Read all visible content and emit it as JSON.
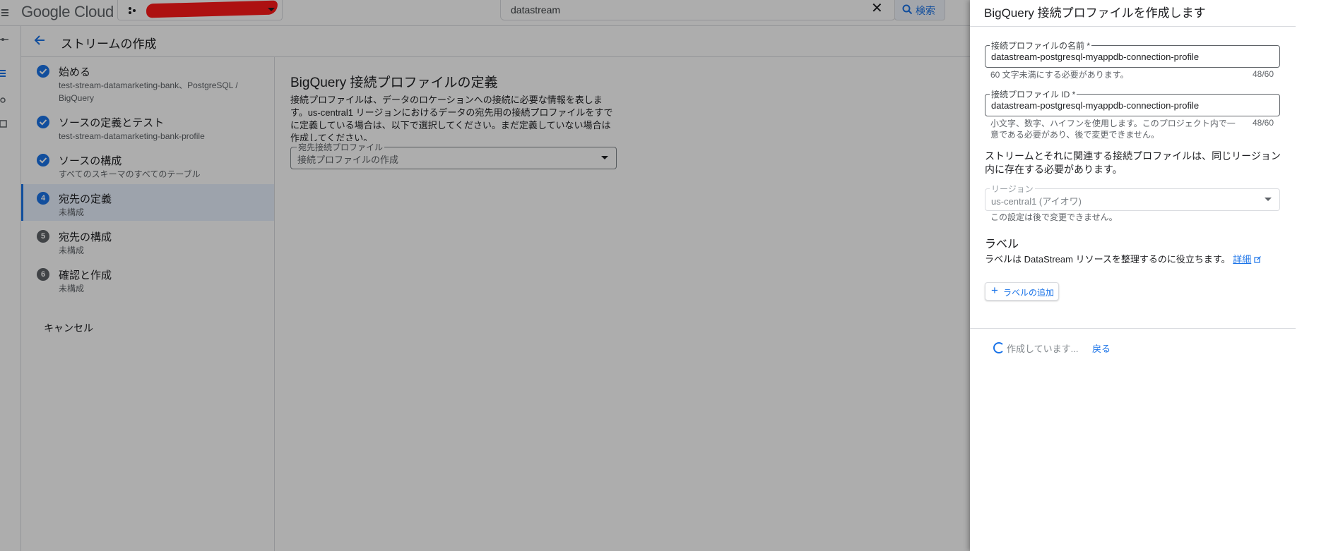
{
  "topbar": {
    "logo": "Google Cloud",
    "search_value": "datastream",
    "search_button": "検索",
    "colors": {
      "brand_blue": "#1a73e8",
      "redaction": "#ff1a1a"
    }
  },
  "header": {
    "title": "ストリームの作成"
  },
  "steps": [
    {
      "title": "始める",
      "subtitle": "test-stream-datamarketing-bank、PostgreSQL / BigQuery",
      "status": "done"
    },
    {
      "title": "ソースの定義とテスト",
      "subtitle": "test-stream-datamarketing-bank-profile",
      "status": "done"
    },
    {
      "title": "ソースの構成",
      "subtitle": "すべてのスキーマのすべてのテーブル",
      "status": "done"
    },
    {
      "title": "宛先の定義",
      "subtitle": "未構成",
      "number": "4",
      "status": "active"
    },
    {
      "title": "宛先の構成",
      "subtitle": "未構成",
      "number": "5",
      "status": "pending"
    },
    {
      "title": "確認と作成",
      "subtitle": "未構成",
      "number": "6",
      "status": "pending"
    }
  ],
  "cancel_label": "キャンセル",
  "main": {
    "title": "BigQuery 接続プロファイルの定義",
    "description": "接続プロファイルは、データのロケーションへの接続に必要な情報を表します。us-central1 リージョンにおけるデータの宛先用の接続プロファイルをすでに定義している場合は、以下で選択してください。まだ定義していない場合は作成してください。",
    "dest_label": "宛先接続プロファイル",
    "dest_value": "接続プロファイルの作成"
  },
  "panel": {
    "title": "BigQuery 接続プロファイルを作成します",
    "name_label": "接続プロファイルの名前 *",
    "name_value": "datastream-postgresql-myappdb-connection-profile",
    "name_hint": "60 文字未満にする必要があります。",
    "name_count": "48/60",
    "id_label": "接続プロファイル ID *",
    "id_value": "datastream-postgresql-myappdb-connection-profile",
    "id_hint": "小文字、数字、ハイフンを使用します。このプロジェクト内で一意である必要があり、後で変更できません。",
    "id_count": "48/60",
    "region_note": "ストリームとそれに関連する接続プロファイルは、同じリージョン内に存在する必要があります。",
    "region_label": "リージョン",
    "region_value": "us-central1 (アイオワ)",
    "region_hint": "この設定は後で変更できません。",
    "labels_title": "ラベル",
    "labels_desc": "ラベルは DataStream リソースを整理するのに役立ちます。",
    "labels_link": "詳細",
    "add_label": "ラベルの追加",
    "creating_text": "作成しています...",
    "back_label": "戻る"
  }
}
